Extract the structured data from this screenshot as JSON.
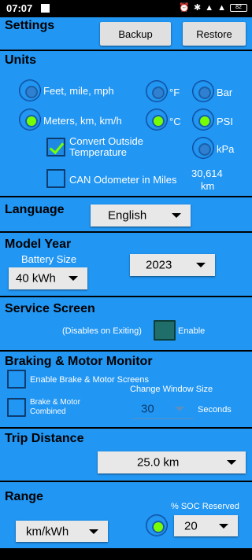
{
  "status": {
    "time": "07:07",
    "battery": "82"
  },
  "settings": {
    "title": "Settings",
    "backup_label": "Backup",
    "restore_label": "Restore"
  },
  "units": {
    "title": "Units",
    "distance_imperial": "Feet, mile, mph",
    "distance_metric": "Meters, km, km/h",
    "temp_f": "°F",
    "temp_c": "°C",
    "pressure_bar": "Bar",
    "pressure_psi": "PSI",
    "pressure_kpa": "kPa",
    "convert_temp": "Convert Outside Temperature",
    "can_odometer": "CAN Odometer in Miles",
    "odometer_value": "30,614",
    "odometer_unit": "km"
  },
  "language": {
    "title": "Language",
    "selected": "English"
  },
  "model_year": {
    "title": "Model Year",
    "battery_label": "Battery Size",
    "battery_selected": "40 kWh",
    "year_selected": "2023"
  },
  "service": {
    "title": "Service Screen",
    "note": "(Disables on Exiting)",
    "enable_label": "Enable"
  },
  "braking": {
    "title": "Braking & Motor Monitor",
    "enable_label": "Enable Brake & Motor Screens",
    "combined_label": "Brake & Motor Combined",
    "window_label": "Change Window Size",
    "window_value": "30",
    "window_unit": "Seconds"
  },
  "trip": {
    "title": "Trip Distance",
    "selected": "25.0 km"
  },
  "range": {
    "title": "Range",
    "soc_label": "% SOC Reserved",
    "unit_selected": "km/kWh",
    "soc_selected": "20"
  },
  "colors": {
    "section_blue": "#2196F3",
    "radio_checked": "#76ff03",
    "button_gray": "#e0e0e0"
  }
}
